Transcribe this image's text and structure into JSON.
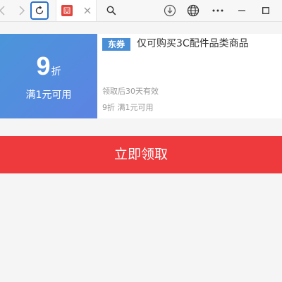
{
  "toolbar": {
    "tab": {
      "favicon_color": "#e0463d"
    },
    "icons": {
      "back": "chevron-left-icon",
      "forward": "chevron-right-icon",
      "reload": "reload-icon",
      "close": "close-icon",
      "search": "search-icon",
      "download": "download-icon",
      "globe": "globe-icon",
      "more": "more-icon",
      "minimize": "minimize-icon",
      "maximize": "maximize-icon"
    }
  },
  "coupon": {
    "discount_value": "9",
    "discount_unit": "折",
    "condition": "满1元可用",
    "tag": "东券",
    "title": "仅可购买3C配件品类商品",
    "validity": "领取后30天有效",
    "rule": "9折 满1元可用",
    "colors": {
      "left_gradient_start": "#4b95da",
      "left_gradient_end": "#5c84e3",
      "tag_bg": "#4a8fd6"
    }
  },
  "claim_button": {
    "label": "立即领取",
    "color": "#ee3a3d"
  }
}
